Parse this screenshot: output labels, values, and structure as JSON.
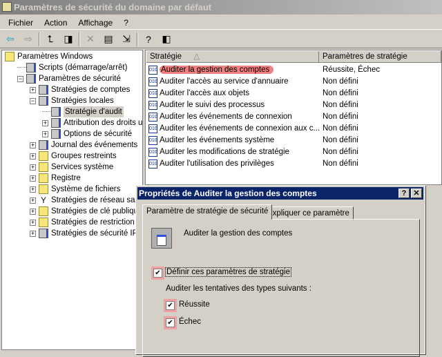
{
  "window": {
    "title": "Paramètres de sécurité du domaine par défaut"
  },
  "menu": [
    "Fichier",
    "Action",
    "Affichage",
    "?"
  ],
  "toolbar": [
    {
      "icon": "back-arrow-icon",
      "glyph": "⇦"
    },
    {
      "icon": "forward-arrow-icon",
      "glyph": "⇨"
    },
    {
      "icon": "up-folder-icon",
      "glyph": "⮤"
    },
    {
      "icon": "show-tree-icon",
      "glyph": "◨"
    },
    {
      "icon": "delete-icon",
      "glyph": "✕"
    },
    {
      "icon": "properties-icon",
      "glyph": "▤"
    },
    {
      "icon": "export-list-icon",
      "glyph": "⇲"
    },
    {
      "icon": "help-icon",
      "glyph": "?"
    },
    {
      "icon": "action-pane-icon",
      "glyph": "◧"
    }
  ],
  "tree": [
    {
      "label": "Paramètres Windows",
      "level": 0,
      "expander": "",
      "icon": "folder"
    },
    {
      "label": "Scripts (démarrage/arrêt)",
      "level": 1,
      "expander": "",
      "icon": "srv"
    },
    {
      "label": "Paramètres de sécurité",
      "level": 1,
      "expander": "−",
      "icon": "srv"
    },
    {
      "label": "Stratégies de comptes",
      "level": 2,
      "expander": "+",
      "icon": "srv"
    },
    {
      "label": "Stratégies locales",
      "level": 2,
      "expander": "−",
      "icon": "srv"
    },
    {
      "label": "Stratégie d'audit",
      "level": 3,
      "expander": "",
      "icon": "srv",
      "selected": true
    },
    {
      "label": "Attribution des droits utili",
      "level": 3,
      "expander": "+",
      "icon": "srv"
    },
    {
      "label": "Options de sécurité",
      "level": 3,
      "expander": "+",
      "icon": "srv"
    },
    {
      "label": "Journal des événements",
      "level": 2,
      "expander": "+",
      "icon": "srv"
    },
    {
      "label": "Groupes restreints",
      "level": 2,
      "expander": "+",
      "icon": "folder"
    },
    {
      "label": "Services système",
      "level": 2,
      "expander": "+",
      "icon": "folder"
    },
    {
      "label": "Registre",
      "level": 2,
      "expander": "+",
      "icon": "folder"
    },
    {
      "label": "Système de fichiers",
      "level": 2,
      "expander": "+",
      "icon": "folder"
    },
    {
      "label": "Stratégies de réseau sans f",
      "level": 2,
      "expander": "+",
      "icon": "antenna"
    },
    {
      "label": "Stratégies de clé publique",
      "level": 2,
      "expander": "+",
      "icon": "folder"
    },
    {
      "label": "Stratégies de restriction log",
      "level": 2,
      "expander": "+",
      "icon": "folder"
    },
    {
      "label": "Stratégies de sécurité IP su",
      "level": 2,
      "expander": "+",
      "icon": "srv"
    }
  ],
  "list": {
    "columns": [
      "Stratégie",
      "Paramètres de stratégie"
    ],
    "rows": [
      {
        "name": "Auditer la gestion des comptes",
        "value": "Réussite, Échec",
        "highlight": true
      },
      {
        "name": "Auditer l'accès au service d'annuaire",
        "value": "Non défini"
      },
      {
        "name": "Auditer l'accès aux objets",
        "value": "Non défini"
      },
      {
        "name": "Auditer le suivi des processus",
        "value": "Non défini"
      },
      {
        "name": "Auditer les événements de connexion",
        "value": "Non défini"
      },
      {
        "name": "Auditer les événements de connexion aux c...",
        "value": "Non défini"
      },
      {
        "name": "Auditer les événements système",
        "value": "Non défini"
      },
      {
        "name": "Auditer les modifications de stratégie",
        "value": "Non défini"
      },
      {
        "name": "Auditer l'utilisation des privilèges",
        "value": "Non défini"
      }
    ]
  },
  "dialog": {
    "title": "Propriétés de Auditer la gestion des comptes",
    "help": "?",
    "close": "✕",
    "tabs": [
      "Paramètre de stratégie de sécurité",
      "Expliquer ce paramètre"
    ],
    "policy_name": "Auditer la gestion des comptes",
    "define_label": "Définir ces paramètres de stratégie",
    "define_checked": true,
    "audit_label": "Auditer les tentatives des types suivants :",
    "success_label": "Réussite",
    "success_checked": true,
    "failure_label": "Échec",
    "failure_checked": true,
    "check_glyph": "✔"
  }
}
